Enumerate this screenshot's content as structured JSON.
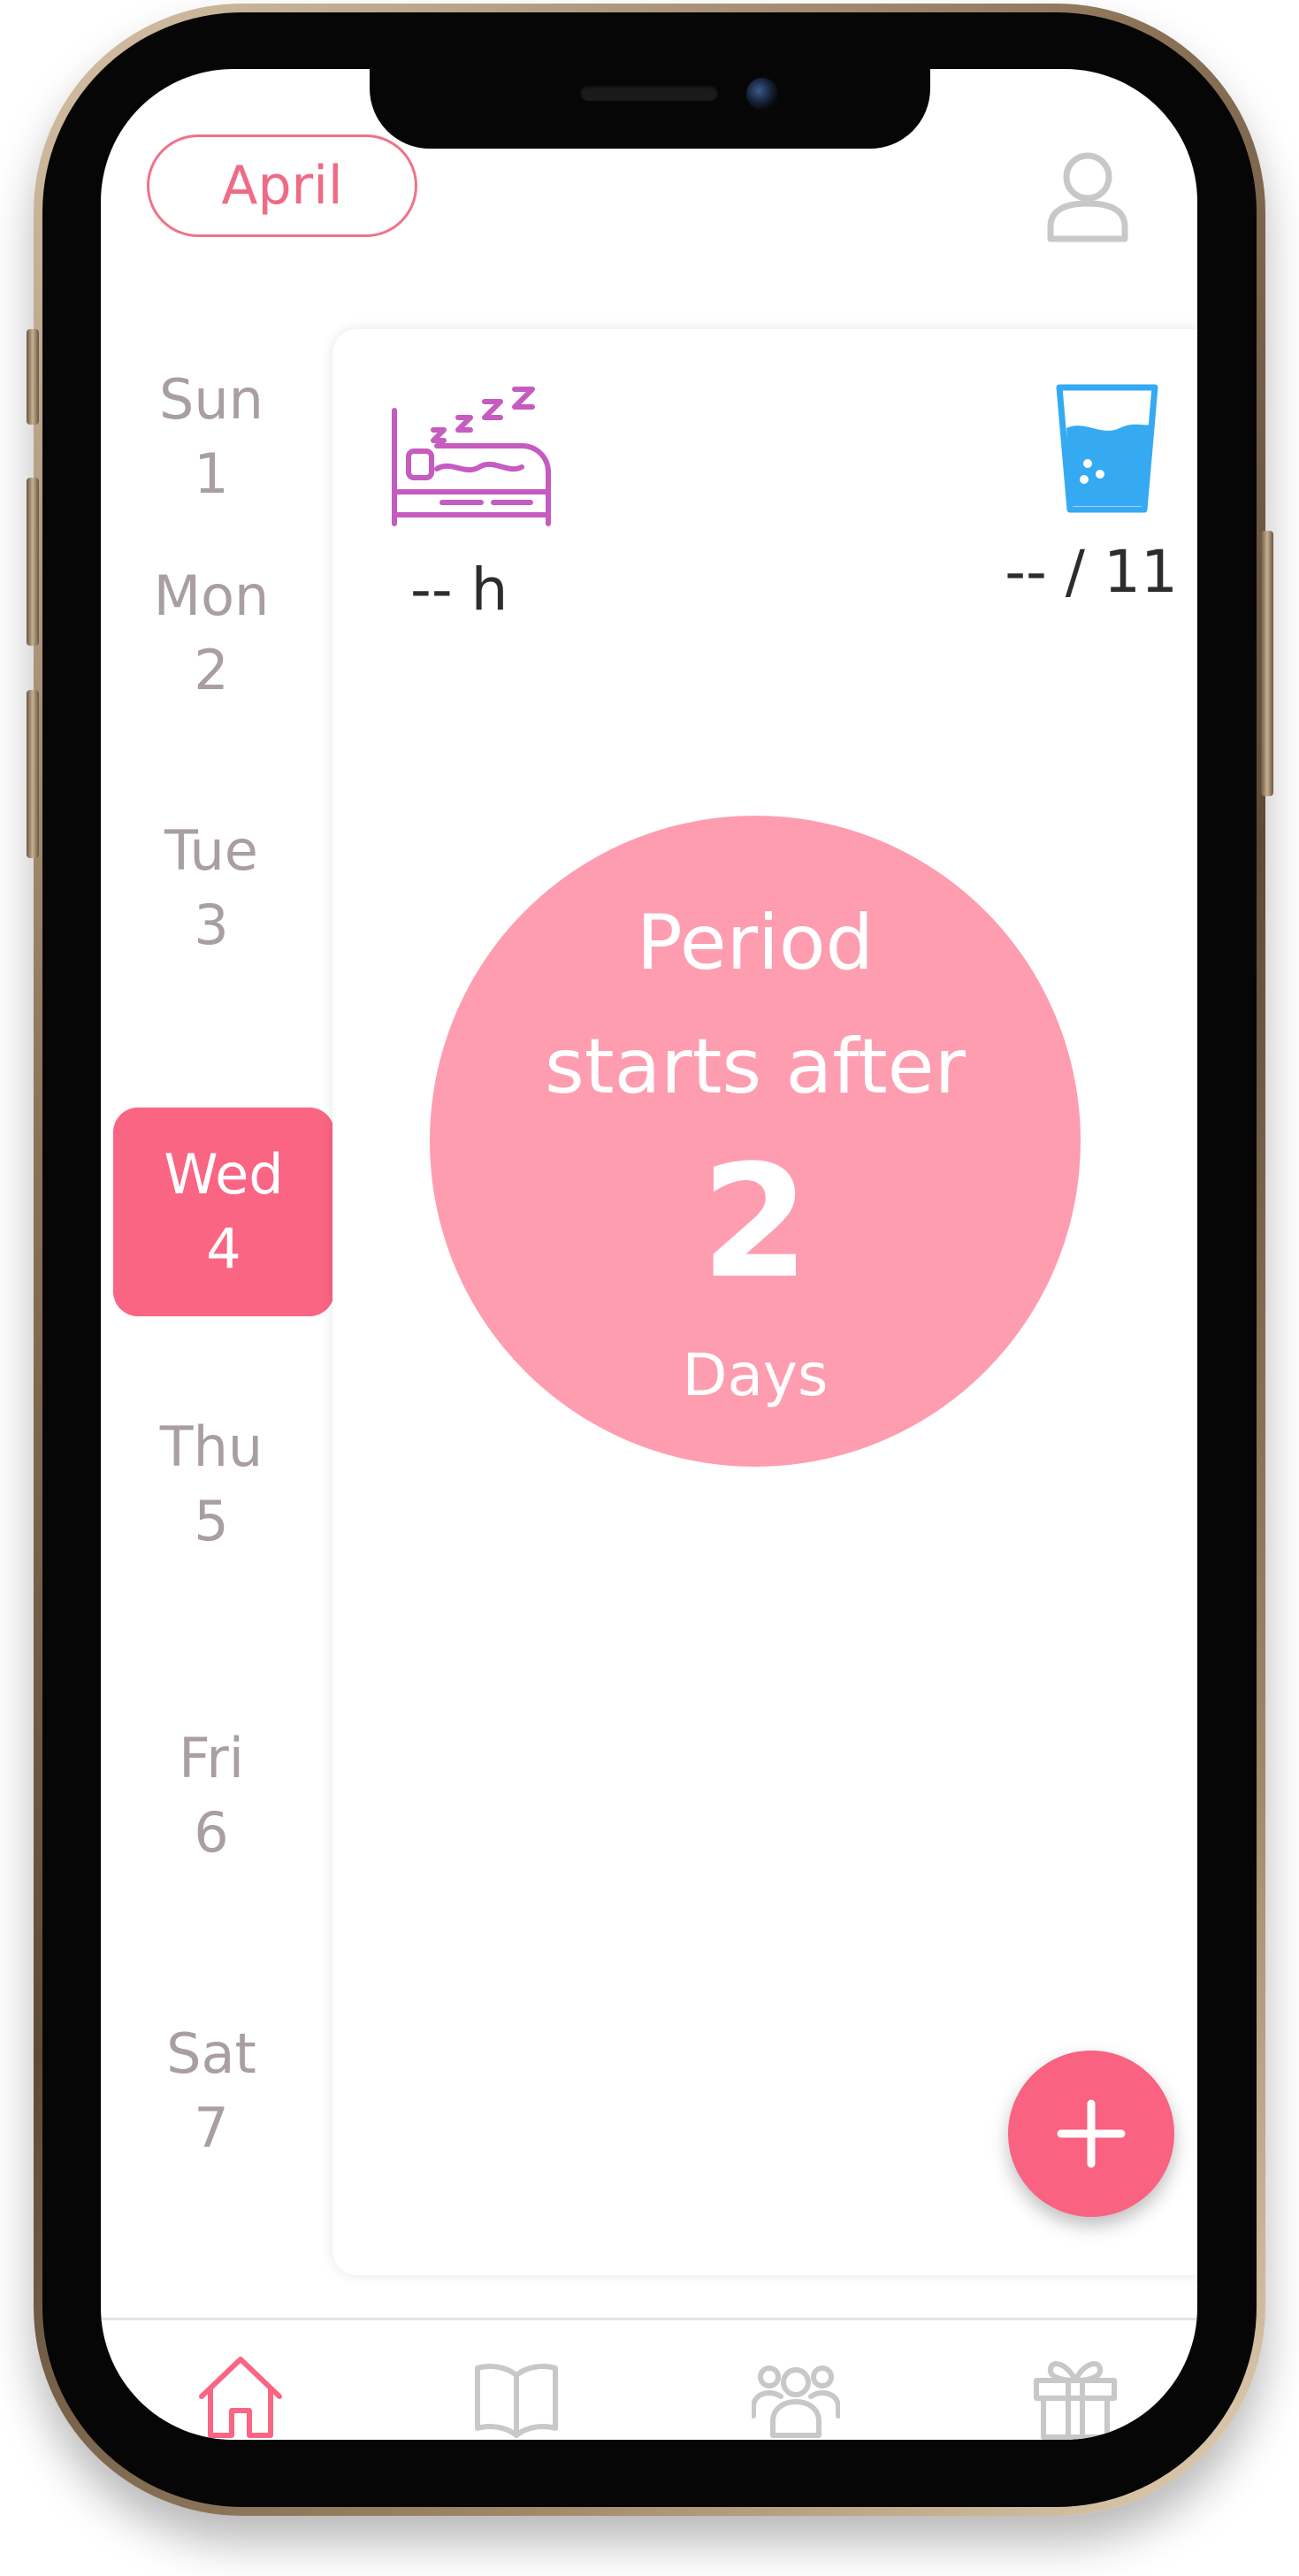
{
  "header": {
    "month": "April",
    "profile_icon": "user-icon"
  },
  "days": [
    {
      "name": "Sun",
      "num": "1",
      "active": false
    },
    {
      "name": "Mon",
      "num": "2",
      "active": false
    },
    {
      "name": "Tue",
      "num": "3",
      "active": false
    },
    {
      "name": "Wed",
      "num": "4",
      "active": true
    },
    {
      "name": "Thu",
      "num": "5",
      "active": false
    },
    {
      "name": "Fri",
      "num": "6",
      "active": false
    },
    {
      "name": "Sat",
      "num": "7",
      "active": false
    }
  ],
  "summary": {
    "sleep": {
      "icon": "bed-sleep-icon",
      "value": "-- h"
    },
    "water": {
      "icon": "water-glass-icon",
      "value": "-- / 11"
    }
  },
  "period": {
    "line1": "Period",
    "line2": "starts after",
    "count": "2",
    "unit": "Days"
  },
  "fab": {
    "icon": "plus-icon"
  },
  "bottom_nav": [
    {
      "id": "home",
      "icon": "home-icon",
      "active": true
    },
    {
      "id": "library",
      "icon": "book-icon",
      "active": false
    },
    {
      "id": "community",
      "icon": "group-icon",
      "active": false
    },
    {
      "id": "rewards",
      "icon": "gift-icon",
      "active": false
    }
  ],
  "colors": {
    "accent": "#fa6583",
    "circle": "#fe9db0",
    "day_text": "#a99ea0",
    "sleep_icon": "#c65bc0",
    "water_icon": "#35aaf2",
    "nav_inactive": "#c8c8c8"
  }
}
